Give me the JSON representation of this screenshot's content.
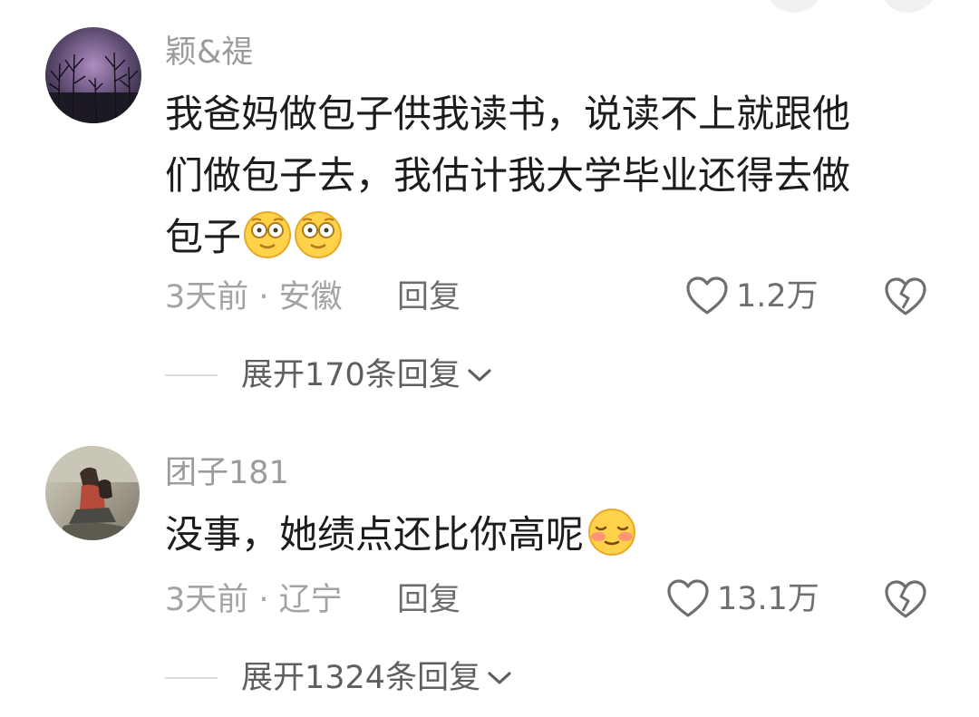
{
  "comments": [
    {
      "username": "颖&禔",
      "text_lines": [
        "我爸妈做包子供我读书，说读不上就跟他",
        "们做包子去，我估计我大学毕业还得去做",
        "包子"
      ],
      "emojis": [
        "dizzy-face-emoji",
        "dizzy-face-emoji"
      ],
      "time_location": "3天前 · 安徽",
      "reply_label": "回复",
      "like_count": "1.2万",
      "expand_label": "展开170条回复"
    },
    {
      "username": "团子181",
      "text_lines": [
        "没事，她绩点还比你高呢"
      ],
      "emojis": [
        "blushing-smile-emoji"
      ],
      "time_location": "3天前 · 辽宁",
      "reply_label": "回复",
      "like_count": "13.1万",
      "expand_label": "展开1324条回复"
    }
  ],
  "colors": {
    "username": "#9b9b9b",
    "text": "#1c1c1c",
    "meta": "#a3a3a3",
    "action": "#6d6d6d",
    "emoji_face": "#ffd24a"
  }
}
